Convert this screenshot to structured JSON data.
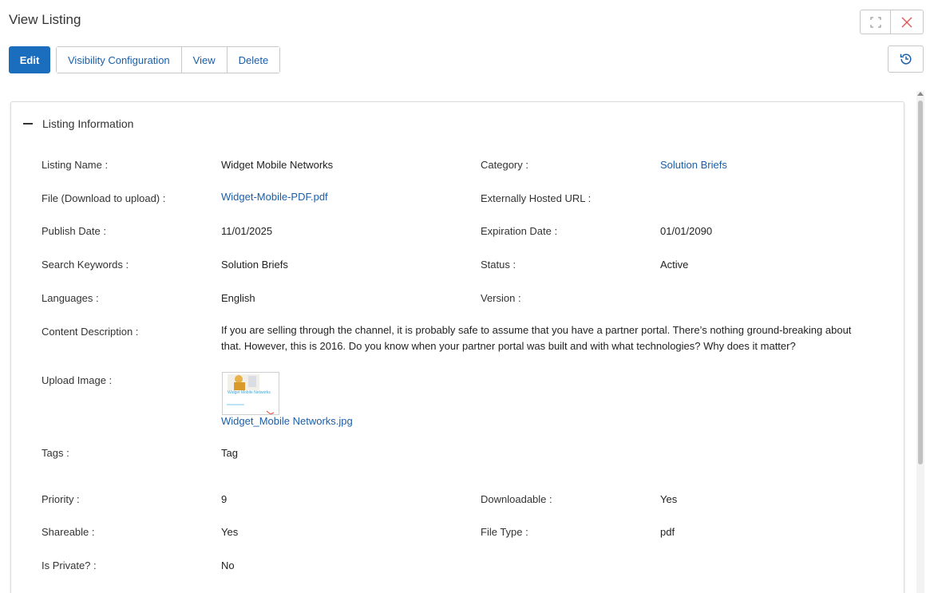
{
  "header": {
    "title": "View Listing"
  },
  "toolbar": {
    "edit_label": "Edit",
    "visibility_label": "Visibility Configuration",
    "view_label": "View",
    "delete_label": "Delete"
  },
  "section": {
    "title": "Listing Information"
  },
  "fields": {
    "listing_name": {
      "label": "Listing Name :",
      "value": "Widget Mobile Networks"
    },
    "category": {
      "label": "Category :",
      "value": "Solution Briefs"
    },
    "file": {
      "label": "File (Download to upload) :",
      "value": "Widget-Mobile-PDF.pdf"
    },
    "external_url": {
      "label": "Externally Hosted URL :",
      "value": ""
    },
    "publish_date": {
      "label": "Publish Date :",
      "value": "11/01/2025"
    },
    "expiration_date": {
      "label": "Expiration Date :",
      "value": "01/01/2090"
    },
    "keywords": {
      "label": "Search Keywords :",
      "value": "Solution Briefs"
    },
    "status": {
      "label": "Status :",
      "value": "Active"
    },
    "languages": {
      "label": "Languages :",
      "value": "English"
    },
    "version": {
      "label": "Version :",
      "value": ""
    },
    "description": {
      "label": "Content Description :",
      "value": "If you are selling through the channel, it is probably safe to assume that you have a partner portal. There’s nothing ground-breaking about that. However, this is 2016. Do you know when your partner portal was built and with what technologies? Why does it matter?"
    },
    "upload_image": {
      "label": "Upload Image :",
      "value": "Widget_Mobile Networks.jpg",
      "thumb_text": "Widget Mobile Networks"
    },
    "tags": {
      "label": "Tags :",
      "value": "Tag"
    },
    "priority": {
      "label": "Priority :",
      "value": "9"
    },
    "downloadable": {
      "label": "Downloadable :",
      "value": "Yes"
    },
    "shareable": {
      "label": "Shareable :",
      "value": "Yes"
    },
    "file_type": {
      "label": "File Type :",
      "value": "pdf"
    },
    "is_private": {
      "label": "Is Private? :",
      "value": "No"
    }
  },
  "colors": {
    "primary": "#1b6dbd",
    "link": "#1b5ea8",
    "close_icon": "#e05555"
  },
  "icons": {
    "expand": "expand-icon",
    "close": "close-icon",
    "history": "history-icon",
    "collapse": "minus-icon"
  }
}
